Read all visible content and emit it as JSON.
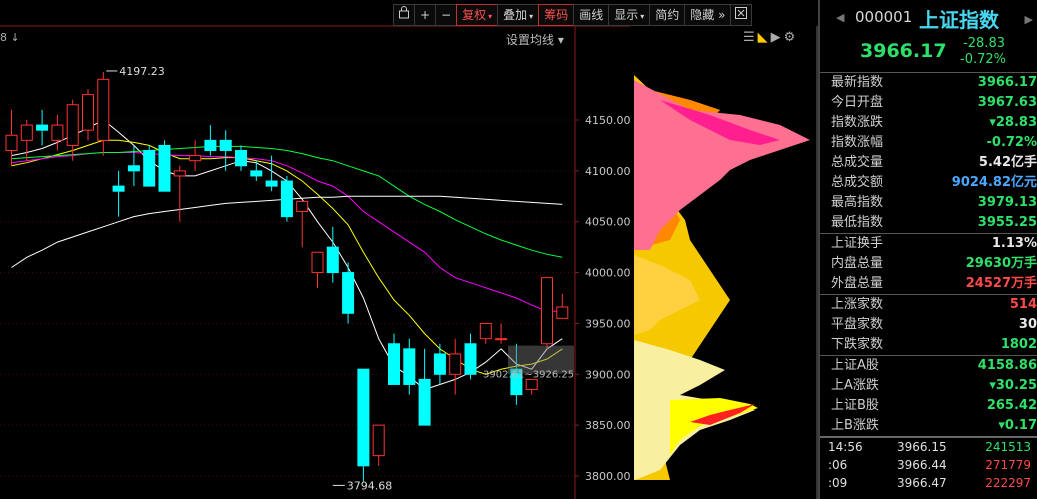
{
  "toolbar": {
    "buttons": [
      {
        "label": "+"
      },
      {
        "label": "−"
      },
      {
        "label": "复权",
        "caret": true,
        "active": true
      },
      {
        "label": "叠加",
        "caret": true
      },
      {
        "label": "筹码",
        "active": true
      },
      {
        "label": "画线"
      },
      {
        "label": "显示",
        "caret": true
      },
      {
        "label": "简约"
      },
      {
        "label": "隐藏",
        "arrows": "»"
      }
    ],
    "setting_ma": "设置均线 ▾",
    "left_stub": "8 ↓"
  },
  "chart_data": {
    "type": "candlestick",
    "y_axis_ticks": [
      "4150.00",
      "4100.00",
      "4050.00",
      "4000.00",
      "3950.00",
      "3900.00",
      "3850.00",
      "3800.00"
    ],
    "ylim": [
      3790,
      4210
    ],
    "annotations": {
      "high": "4197.23",
      "low": "3794.68",
      "cost_range": "3902.61~3926.25"
    },
    "candles": [
      {
        "o": 4120,
        "h": 4160,
        "l": 4105,
        "c": 4135
      },
      {
        "o": 4130,
        "h": 4150,
        "l": 4110,
        "c": 4145
      },
      {
        "o": 4145,
        "h": 4160,
        "l": 4125,
        "c": 4140
      },
      {
        "o": 4130,
        "h": 4155,
        "l": 4120,
        "c": 4145
      },
      {
        "o": 4125,
        "h": 4170,
        "l": 4110,
        "c": 4165
      },
      {
        "o": 4140,
        "h": 4180,
        "l": 4130,
        "c": 4175
      },
      {
        "o": 4130,
        "h": 4197.23,
        "l": 4115,
        "c": 4190
      },
      {
        "o": 4085,
        "h": 4100,
        "l": 4055,
        "c": 4080
      },
      {
        "o": 4105,
        "h": 4125,
        "l": 4085,
        "c": 4100
      },
      {
        "o": 4120,
        "h": 4125,
        "l": 4085,
        "c": 4085
      },
      {
        "o": 4125,
        "h": 4130,
        "l": 4085,
        "c": 4080
      },
      {
        "o": 4095,
        "h": 4105,
        "l": 4050,
        "c": 4100
      },
      {
        "o": 4110,
        "h": 4130,
        "l": 4100,
        "c": 4115
      },
      {
        "o": 4130,
        "h": 4145,
        "l": 4115,
        "c": 4120
      },
      {
        "o": 4130,
        "h": 4140,
        "l": 4100,
        "c": 4120
      },
      {
        "o": 4120,
        "h": 4125,
        "l": 4100,
        "c": 4105
      },
      {
        "o": 4100,
        "h": 4110,
        "l": 4090,
        "c": 4095
      },
      {
        "o": 4090,
        "h": 4115,
        "l": 4080,
        "c": 4085
      },
      {
        "o": 4090,
        "h": 4095,
        "l": 4050,
        "c": 4055
      },
      {
        "o": 4060,
        "h": 4070,
        "l": 4025,
        "c": 4070
      },
      {
        "o": 4000,
        "h": 4005,
        "l": 3985,
        "c": 4020
      },
      {
        "o": 4025,
        "h": 4045,
        "l": 3990,
        "c": 4000
      },
      {
        "o": 4000,
        "h": 4010,
        "l": 3950,
        "c": 3960
      },
      {
        "o": 3905,
        "h": 3905,
        "l": 3794.68,
        "c": 3810
      },
      {
        "o": 3820,
        "h": 3835,
        "l": 3810,
        "c": 3850
      },
      {
        "o": 3930,
        "h": 3940,
        "l": 3890,
        "c": 3890
      },
      {
        "o": 3925,
        "h": 3935,
        "l": 3880,
        "c": 3890
      },
      {
        "o": 3895,
        "h": 3925,
        "l": 3850,
        "c": 3850
      },
      {
        "o": 3920,
        "h": 3930,
        "l": 3890,
        "c": 3900
      },
      {
        "o": 3900,
        "h": 3935,
        "l": 3880,
        "c": 3920
      },
      {
        "o": 3930,
        "h": 3940,
        "l": 3895,
        "c": 3900
      },
      {
        "o": 3935,
        "h": 3945,
        "l": 3930,
        "c": 3950
      },
      {
        "o": 3935,
        "h": 3950,
        "l": 3930,
        "c": 3935
      },
      {
        "o": 3905,
        "h": 3930,
        "l": 3870,
        "c": 3880
      },
      {
        "o": 3885,
        "h": 3895,
        "l": 3880,
        "c": 3895
      },
      {
        "o": 3930,
        "h": 3995,
        "l": 3925,
        "c": 3995
      },
      {
        "o": 3955,
        "h": 3979.13,
        "l": 3955.25,
        "c": 3966.17
      }
    ],
    "ma_lines": [
      {
        "color": "#ffffff",
        "values": [
          4115,
          4118,
          4122,
          4128,
          4135,
          4142,
          4150,
          4138,
          4125,
          4110,
          4100,
          4095,
          4095,
          4100,
          4105,
          4110,
          4108,
          4100,
          4090,
          4072,
          4050,
          4030,
          4005,
          3975,
          3935,
          3908,
          3898,
          3885,
          3890,
          3895,
          3902,
          3912,
          3925,
          3910,
          3905,
          3925,
          3935
        ]
      },
      {
        "color": "#ffff00",
        "values": [
          4105,
          4108,
          4112,
          4116,
          4120,
          4125,
          4130,
          4130,
          4128,
          4125,
          4118,
          4112,
          4112,
          4112,
          4113,
          4113,
          4110,
          4107,
          4100,
          4090,
          4077,
          4063,
          4047,
          4020,
          3995,
          3973,
          3958,
          3940,
          3925,
          3915,
          3905,
          3900,
          3905,
          3908,
          3910,
          3915,
          3925
        ]
      },
      {
        "color": "#ff00ff",
        "values": [
          4108,
          4110,
          4112,
          4114,
          4115,
          4117,
          4118,
          4118,
          4118,
          4117,
          4116,
          4115,
          4115,
          4114,
          4114,
          4113,
          4112,
          4110,
          4105,
          4098,
          4090,
          4085,
          4075,
          4060,
          4050,
          4040,
          4030,
          4020,
          4005,
          3995,
          3990,
          3985,
          3980,
          3975,
          3968,
          3962,
          3962
        ]
      },
      {
        "color": "#00ff40",
        "values": [
          4112,
          4113,
          4114,
          4115,
          4116,
          4117,
          4118,
          4118,
          4119,
          4120,
          4121,
          4122,
          4123,
          4124,
          4124,
          4124,
          4123,
          4122,
          4120,
          4117,
          4113,
          4110,
          4105,
          4100,
          4095,
          4085,
          4075,
          4067,
          4060,
          4052,
          4045,
          4038,
          4032,
          4027,
          4022,
          4018,
          4015
        ]
      },
      {
        "color": "#ffffff",
        "values": [
          4005,
          4015,
          4022,
          4030,
          4035,
          4040,
          4045,
          4050,
          4055,
          4058,
          4060,
          4062,
          4064,
          4066,
          4068,
          4069,
          4070,
          4071,
          4072,
          4073,
          4074,
          4074,
          4075,
          4075,
          4075,
          4075,
          4075,
          4075,
          4075,
          4074,
          4073,
          4072,
          4071,
          4070,
          4069,
          4068,
          4067
        ]
      }
    ]
  },
  "header": {
    "code": "000001",
    "name": "上证指数",
    "price": "3966.17",
    "change": "-28.83",
    "change_pct": "-0.72%"
  },
  "stats": [
    {
      "label": "最新指数",
      "value": "3966.17",
      "color": "g"
    },
    {
      "label": "今日开盘",
      "value": "3967.63",
      "color": "g"
    },
    {
      "label": "指数涨跌",
      "value": "▾28.83",
      "color": "g"
    },
    {
      "label": "指数涨幅",
      "value": "-0.72%",
      "color": "g"
    },
    {
      "label": "总成交量",
      "value": "5.42亿手",
      "color": "w"
    },
    {
      "label": "总成交额",
      "value": "9024.82亿元",
      "color": "b"
    },
    {
      "label": "最高指数",
      "value": "3979.13",
      "color": "g"
    },
    {
      "label": "最低指数",
      "value": "3955.25",
      "color": "g"
    }
  ],
  "stats2": [
    {
      "label": "上证换手",
      "value": "1.13%",
      "color": "w"
    },
    {
      "label": "内盘总量",
      "value": "29630万手",
      "color": "g"
    },
    {
      "label": "外盘总量",
      "value": "24527万手",
      "color": "r"
    }
  ],
  "stats3": [
    {
      "label": "上涨家数",
      "value": "514",
      "color": "r"
    },
    {
      "label": "平盘家数",
      "value": "30",
      "color": "w"
    },
    {
      "label": "下跌家数",
      "value": "1802",
      "color": "g"
    }
  ],
  "stats4": [
    {
      "label": "上证A股",
      "value": "4158.86",
      "color": "g"
    },
    {
      "label": "上A涨跌",
      "value": "▾30.25",
      "color": "g"
    },
    {
      "label": "上证B股",
      "value": "265.42",
      "color": "g"
    },
    {
      "label": "上B涨跌",
      "value": "▾0.17",
      "color": "g"
    }
  ],
  "ticks": [
    {
      "time": "14:56",
      "price": "3966.15",
      "vol": "241513",
      "color": "g"
    },
    {
      "time": ":06",
      "price": "3966.44",
      "vol": "271779",
      "color": "r"
    },
    {
      "time": ":09",
      "price": "3966.47",
      "vol": "222297",
      "color": "r"
    }
  ]
}
